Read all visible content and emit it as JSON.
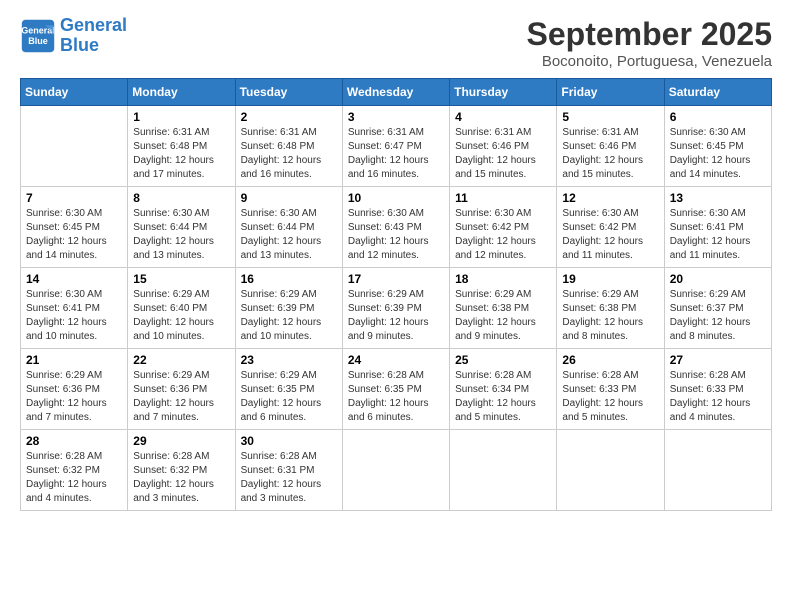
{
  "header": {
    "logo_line1": "General",
    "logo_line2": "Blue",
    "month": "September 2025",
    "location": "Boconoito, Portuguesa, Venezuela"
  },
  "weekdays": [
    "Sunday",
    "Monday",
    "Tuesday",
    "Wednesday",
    "Thursday",
    "Friday",
    "Saturday"
  ],
  "weeks": [
    [
      {
        "day": "",
        "info": ""
      },
      {
        "day": "1",
        "info": "Sunrise: 6:31 AM\nSunset: 6:48 PM\nDaylight: 12 hours\nand 17 minutes."
      },
      {
        "day": "2",
        "info": "Sunrise: 6:31 AM\nSunset: 6:48 PM\nDaylight: 12 hours\nand 16 minutes."
      },
      {
        "day": "3",
        "info": "Sunrise: 6:31 AM\nSunset: 6:47 PM\nDaylight: 12 hours\nand 16 minutes."
      },
      {
        "day": "4",
        "info": "Sunrise: 6:31 AM\nSunset: 6:46 PM\nDaylight: 12 hours\nand 15 minutes."
      },
      {
        "day": "5",
        "info": "Sunrise: 6:31 AM\nSunset: 6:46 PM\nDaylight: 12 hours\nand 15 minutes."
      },
      {
        "day": "6",
        "info": "Sunrise: 6:30 AM\nSunset: 6:45 PM\nDaylight: 12 hours\nand 14 minutes."
      }
    ],
    [
      {
        "day": "7",
        "info": "Sunrise: 6:30 AM\nSunset: 6:45 PM\nDaylight: 12 hours\nand 14 minutes."
      },
      {
        "day": "8",
        "info": "Sunrise: 6:30 AM\nSunset: 6:44 PM\nDaylight: 12 hours\nand 13 minutes."
      },
      {
        "day": "9",
        "info": "Sunrise: 6:30 AM\nSunset: 6:44 PM\nDaylight: 12 hours\nand 13 minutes."
      },
      {
        "day": "10",
        "info": "Sunrise: 6:30 AM\nSunset: 6:43 PM\nDaylight: 12 hours\nand 12 minutes."
      },
      {
        "day": "11",
        "info": "Sunrise: 6:30 AM\nSunset: 6:42 PM\nDaylight: 12 hours\nand 12 minutes."
      },
      {
        "day": "12",
        "info": "Sunrise: 6:30 AM\nSunset: 6:42 PM\nDaylight: 12 hours\nand 11 minutes."
      },
      {
        "day": "13",
        "info": "Sunrise: 6:30 AM\nSunset: 6:41 PM\nDaylight: 12 hours\nand 11 minutes."
      }
    ],
    [
      {
        "day": "14",
        "info": "Sunrise: 6:30 AM\nSunset: 6:41 PM\nDaylight: 12 hours\nand 10 minutes."
      },
      {
        "day": "15",
        "info": "Sunrise: 6:29 AM\nSunset: 6:40 PM\nDaylight: 12 hours\nand 10 minutes."
      },
      {
        "day": "16",
        "info": "Sunrise: 6:29 AM\nSunset: 6:39 PM\nDaylight: 12 hours\nand 10 minutes."
      },
      {
        "day": "17",
        "info": "Sunrise: 6:29 AM\nSunset: 6:39 PM\nDaylight: 12 hours\nand 9 minutes."
      },
      {
        "day": "18",
        "info": "Sunrise: 6:29 AM\nSunset: 6:38 PM\nDaylight: 12 hours\nand 9 minutes."
      },
      {
        "day": "19",
        "info": "Sunrise: 6:29 AM\nSunset: 6:38 PM\nDaylight: 12 hours\nand 8 minutes."
      },
      {
        "day": "20",
        "info": "Sunrise: 6:29 AM\nSunset: 6:37 PM\nDaylight: 12 hours\nand 8 minutes."
      }
    ],
    [
      {
        "day": "21",
        "info": "Sunrise: 6:29 AM\nSunset: 6:36 PM\nDaylight: 12 hours\nand 7 minutes."
      },
      {
        "day": "22",
        "info": "Sunrise: 6:29 AM\nSunset: 6:36 PM\nDaylight: 12 hours\nand 7 minutes."
      },
      {
        "day": "23",
        "info": "Sunrise: 6:29 AM\nSunset: 6:35 PM\nDaylight: 12 hours\nand 6 minutes."
      },
      {
        "day": "24",
        "info": "Sunrise: 6:28 AM\nSunset: 6:35 PM\nDaylight: 12 hours\nand 6 minutes."
      },
      {
        "day": "25",
        "info": "Sunrise: 6:28 AM\nSunset: 6:34 PM\nDaylight: 12 hours\nand 5 minutes."
      },
      {
        "day": "26",
        "info": "Sunrise: 6:28 AM\nSunset: 6:33 PM\nDaylight: 12 hours\nand 5 minutes."
      },
      {
        "day": "27",
        "info": "Sunrise: 6:28 AM\nSunset: 6:33 PM\nDaylight: 12 hours\nand 4 minutes."
      }
    ],
    [
      {
        "day": "28",
        "info": "Sunrise: 6:28 AM\nSunset: 6:32 PM\nDaylight: 12 hours\nand 4 minutes."
      },
      {
        "day": "29",
        "info": "Sunrise: 6:28 AM\nSunset: 6:32 PM\nDaylight: 12 hours\nand 3 minutes."
      },
      {
        "day": "30",
        "info": "Sunrise: 6:28 AM\nSunset: 6:31 PM\nDaylight: 12 hours\nand 3 minutes."
      },
      {
        "day": "",
        "info": ""
      },
      {
        "day": "",
        "info": ""
      },
      {
        "day": "",
        "info": ""
      },
      {
        "day": "",
        "info": ""
      }
    ]
  ]
}
